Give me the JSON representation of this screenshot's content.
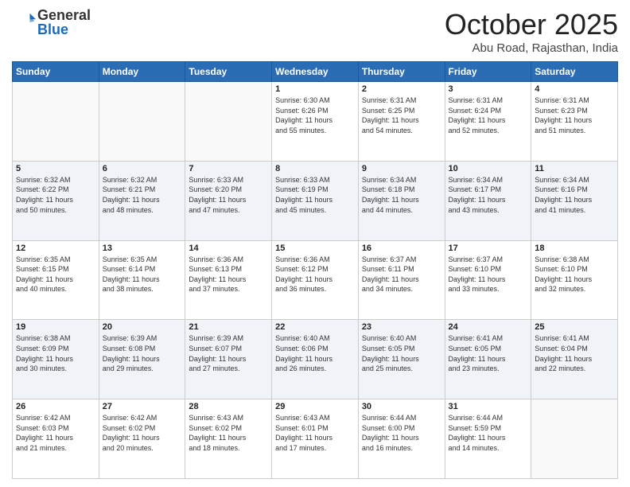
{
  "header": {
    "logo_general": "General",
    "logo_blue": "Blue",
    "month": "October 2025",
    "location": "Abu Road, Rajasthan, India"
  },
  "days_of_week": [
    "Sunday",
    "Monday",
    "Tuesday",
    "Wednesday",
    "Thursday",
    "Friday",
    "Saturday"
  ],
  "weeks": [
    [
      {
        "day": "",
        "info": ""
      },
      {
        "day": "",
        "info": ""
      },
      {
        "day": "",
        "info": ""
      },
      {
        "day": "1",
        "info": "Sunrise: 6:30 AM\nSunset: 6:26 PM\nDaylight: 11 hours\nand 55 minutes."
      },
      {
        "day": "2",
        "info": "Sunrise: 6:31 AM\nSunset: 6:25 PM\nDaylight: 11 hours\nand 54 minutes."
      },
      {
        "day": "3",
        "info": "Sunrise: 6:31 AM\nSunset: 6:24 PM\nDaylight: 11 hours\nand 52 minutes."
      },
      {
        "day": "4",
        "info": "Sunrise: 6:31 AM\nSunset: 6:23 PM\nDaylight: 11 hours\nand 51 minutes."
      }
    ],
    [
      {
        "day": "5",
        "info": "Sunrise: 6:32 AM\nSunset: 6:22 PM\nDaylight: 11 hours\nand 50 minutes."
      },
      {
        "day": "6",
        "info": "Sunrise: 6:32 AM\nSunset: 6:21 PM\nDaylight: 11 hours\nand 48 minutes."
      },
      {
        "day": "7",
        "info": "Sunrise: 6:33 AM\nSunset: 6:20 PM\nDaylight: 11 hours\nand 47 minutes."
      },
      {
        "day": "8",
        "info": "Sunrise: 6:33 AM\nSunset: 6:19 PM\nDaylight: 11 hours\nand 45 minutes."
      },
      {
        "day": "9",
        "info": "Sunrise: 6:34 AM\nSunset: 6:18 PM\nDaylight: 11 hours\nand 44 minutes."
      },
      {
        "day": "10",
        "info": "Sunrise: 6:34 AM\nSunset: 6:17 PM\nDaylight: 11 hours\nand 43 minutes."
      },
      {
        "day": "11",
        "info": "Sunrise: 6:34 AM\nSunset: 6:16 PM\nDaylight: 11 hours\nand 41 minutes."
      }
    ],
    [
      {
        "day": "12",
        "info": "Sunrise: 6:35 AM\nSunset: 6:15 PM\nDaylight: 11 hours\nand 40 minutes."
      },
      {
        "day": "13",
        "info": "Sunrise: 6:35 AM\nSunset: 6:14 PM\nDaylight: 11 hours\nand 38 minutes."
      },
      {
        "day": "14",
        "info": "Sunrise: 6:36 AM\nSunset: 6:13 PM\nDaylight: 11 hours\nand 37 minutes."
      },
      {
        "day": "15",
        "info": "Sunrise: 6:36 AM\nSunset: 6:12 PM\nDaylight: 11 hours\nand 36 minutes."
      },
      {
        "day": "16",
        "info": "Sunrise: 6:37 AM\nSunset: 6:11 PM\nDaylight: 11 hours\nand 34 minutes."
      },
      {
        "day": "17",
        "info": "Sunrise: 6:37 AM\nSunset: 6:10 PM\nDaylight: 11 hours\nand 33 minutes."
      },
      {
        "day": "18",
        "info": "Sunrise: 6:38 AM\nSunset: 6:10 PM\nDaylight: 11 hours\nand 32 minutes."
      }
    ],
    [
      {
        "day": "19",
        "info": "Sunrise: 6:38 AM\nSunset: 6:09 PM\nDaylight: 11 hours\nand 30 minutes."
      },
      {
        "day": "20",
        "info": "Sunrise: 6:39 AM\nSunset: 6:08 PM\nDaylight: 11 hours\nand 29 minutes."
      },
      {
        "day": "21",
        "info": "Sunrise: 6:39 AM\nSunset: 6:07 PM\nDaylight: 11 hours\nand 27 minutes."
      },
      {
        "day": "22",
        "info": "Sunrise: 6:40 AM\nSunset: 6:06 PM\nDaylight: 11 hours\nand 26 minutes."
      },
      {
        "day": "23",
        "info": "Sunrise: 6:40 AM\nSunset: 6:05 PM\nDaylight: 11 hours\nand 25 minutes."
      },
      {
        "day": "24",
        "info": "Sunrise: 6:41 AM\nSunset: 6:05 PM\nDaylight: 11 hours\nand 23 minutes."
      },
      {
        "day": "25",
        "info": "Sunrise: 6:41 AM\nSunset: 6:04 PM\nDaylight: 11 hours\nand 22 minutes."
      }
    ],
    [
      {
        "day": "26",
        "info": "Sunrise: 6:42 AM\nSunset: 6:03 PM\nDaylight: 11 hours\nand 21 minutes."
      },
      {
        "day": "27",
        "info": "Sunrise: 6:42 AM\nSunset: 6:02 PM\nDaylight: 11 hours\nand 20 minutes."
      },
      {
        "day": "28",
        "info": "Sunrise: 6:43 AM\nSunset: 6:02 PM\nDaylight: 11 hours\nand 18 minutes."
      },
      {
        "day": "29",
        "info": "Sunrise: 6:43 AM\nSunset: 6:01 PM\nDaylight: 11 hours\nand 17 minutes."
      },
      {
        "day": "30",
        "info": "Sunrise: 6:44 AM\nSunset: 6:00 PM\nDaylight: 11 hours\nand 16 minutes."
      },
      {
        "day": "31",
        "info": "Sunrise: 6:44 AM\nSunset: 5:59 PM\nDaylight: 11 hours\nand 14 minutes."
      },
      {
        "day": "",
        "info": ""
      }
    ]
  ]
}
